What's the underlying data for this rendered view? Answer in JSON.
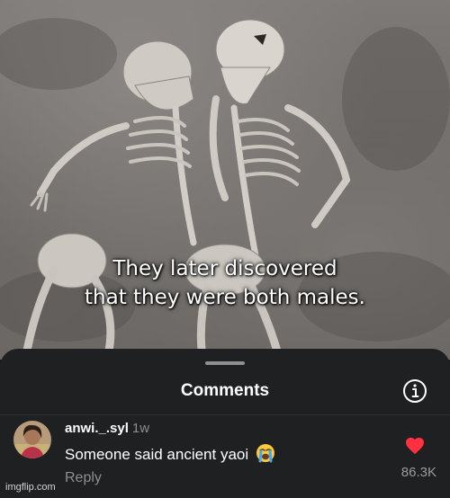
{
  "image": {
    "caption_lines": [
      "They later discovered",
      "that they were both males."
    ]
  },
  "comments_sheet": {
    "title": "Comments",
    "info_icon": "info-icon"
  },
  "comment": {
    "username": "anwi._.syl",
    "time": "1w",
    "text": "Someone said ancient yaoi",
    "emoji": "😭",
    "reply_label": "Reply",
    "like_count": "86.3K",
    "liked": true,
    "heart_color": "#ff3040"
  },
  "watermark": "imgflip.com"
}
